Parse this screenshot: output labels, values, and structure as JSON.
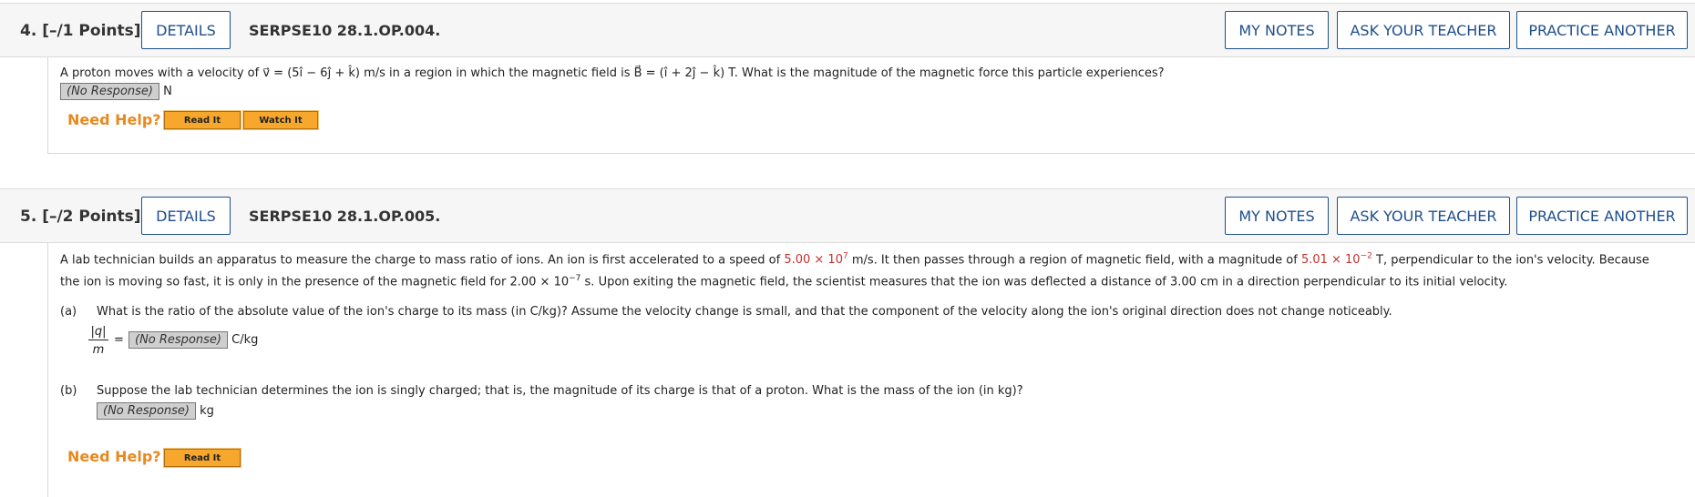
{
  "q4": {
    "number": "4.  [–/1 Points]",
    "details": "DETAILS",
    "code": "SERPSE10 28.1.OP.004.",
    "my_notes": "MY NOTES",
    "ask": "ASK YOUR TEACHER",
    "practice": "PRACTICE ANOTHER",
    "question": "A proton moves with a velocity of v⃗ = (5î − 6ĵ + k̂) m/s in a region in which the magnetic field is B⃗ = (î + 2ĵ − k̂) T. What is the magnitude of the magnetic force this particle experiences?",
    "response": "(No Response)",
    "unit": "N",
    "need_help": "Need Help?",
    "read_it": "Read It",
    "watch_it": "Watch It"
  },
  "q5": {
    "number": "5.  [–/2 Points]",
    "details": "DETAILS",
    "code": "SERPSE10 28.1.OP.005.",
    "my_notes": "MY NOTES",
    "ask": "ASK YOUR TEACHER",
    "practice": "PRACTICE ANOTHER",
    "line1_a": "A lab technician builds an apparatus to measure the charge to mass ratio of ions. An ion is first accelerated to a speed of ",
    "speed_mant": "5.00 × 10",
    "speed_exp": "7",
    "line1_b": " m/s. It then passes through a region of magnetic field, with a magnitude of ",
    "field_mant": "5.01 × 10",
    "field_exp": "−2",
    "line1_c": " T, perpendicular to the ion's velocity. Because",
    "line2_a": "the ion is moving so fast, it is only in the presence of the magnetic field for 2.00 × 10",
    "time_exp": "−7",
    "line2_b": " s. Upon exiting the magnetic field, the scientist measures that the ion was deflected a distance of 3.00 cm in a direction perpendicular to its initial velocity.",
    "part_a_label": "(a)",
    "part_a_text": "What is the ratio of the absolute value of the ion's charge to its mass (in C/kg)? Assume the velocity change is small, and that the component of the velocity along the ion's original direction does not change noticeably.",
    "frac_num": "|q|",
    "frac_den": "m",
    "equals": "=",
    "response_a": "(No Response)",
    "unit_a": "C/kg",
    "part_b_label": "(b)",
    "part_b_text": "Suppose the lab technician determines the ion is singly charged; that is, the magnitude of its charge is that of a proton. What is the mass of the ion (in kg)?",
    "response_b": "(No Response)",
    "unit_b": "kg",
    "need_help": "Need Help?",
    "read_it": "Read It"
  },
  "colors": {
    "accent": "#1f4e8c",
    "help": "#e8891e",
    "given_value": "#c8312b"
  }
}
